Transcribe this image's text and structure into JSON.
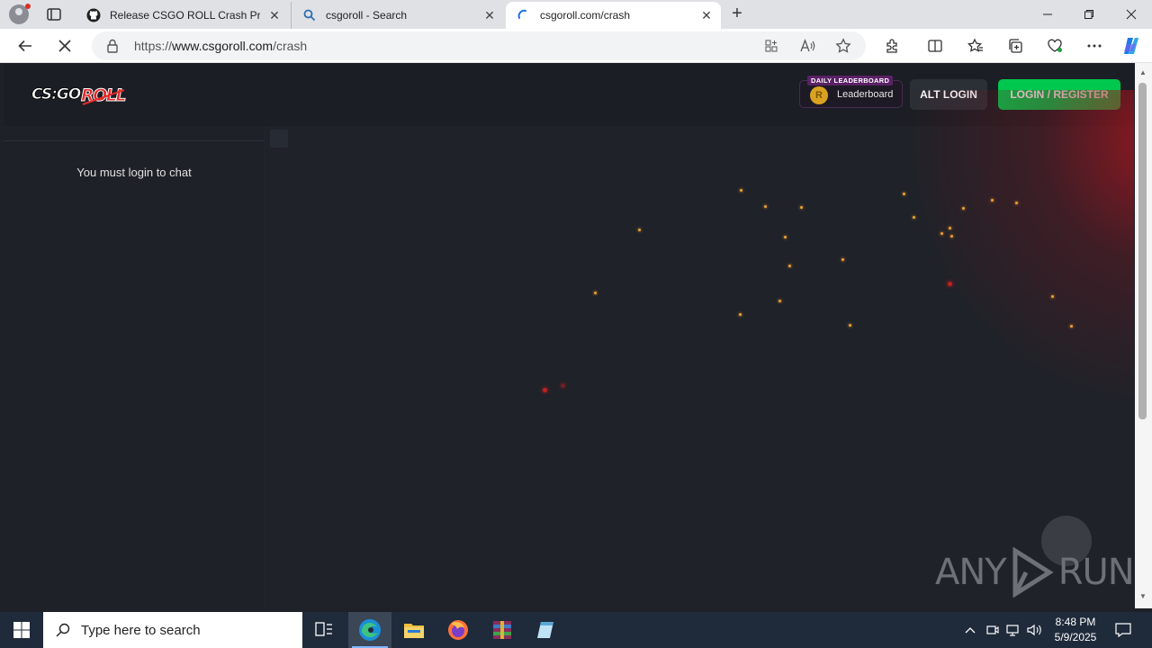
{
  "browser": {
    "tabs": [
      {
        "title": "Release CSGO ROLL Crash Predic",
        "favicon": "github-icon"
      },
      {
        "title": "csgoroll - Search",
        "favicon": "search-icon"
      },
      {
        "title": "csgoroll.com/crash",
        "favicon": "loading-icon"
      }
    ],
    "url_prefix": "https://",
    "url_domain": "www.csgoroll.com",
    "url_path": "/crash"
  },
  "header": {
    "logo_text": "CS:GO ROLL",
    "leaderboard_tag": "DAILY LEADERBOARD",
    "leaderboard_label": "Leaderboard",
    "alt_login": "ALT LOGIN",
    "login_register": "LOGIN / REGISTER"
  },
  "chat": {
    "message": "You must login to chat"
  },
  "watermark": {
    "left": "ANY",
    "right": "RUN"
  },
  "taskbar": {
    "search_placeholder": "Type here to search",
    "time": "8:48 PM",
    "date": "5/9/2025"
  },
  "colors": {
    "accent_green": "#00c74d",
    "page_bg": "#1e2127",
    "spark": "#f0a030"
  }
}
